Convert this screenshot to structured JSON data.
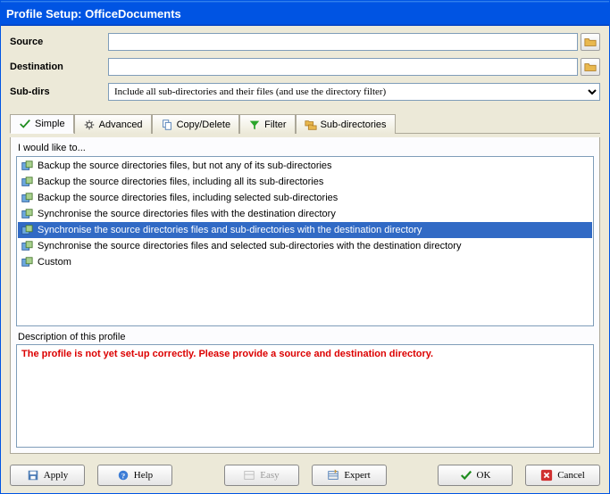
{
  "window": {
    "title": "Profile Setup: OfficeDocuments"
  },
  "form": {
    "source_label": "Source",
    "source_value": "",
    "dest_label": "Destination",
    "dest_value": "",
    "subdirs_label": "Sub-dirs",
    "subdirs_value": "Include all sub-directories and their files (and use the directory filter)"
  },
  "tabs": {
    "simple": "Simple",
    "advanced": "Advanced",
    "copydelete": "Copy/Delete",
    "filter": "Filter",
    "subdirectories": "Sub-directories"
  },
  "panel": {
    "prompt": "I would like to...",
    "options": [
      "Backup the source directories files, but not any of its sub-directories",
      "Backup the source directories files, including all its sub-directories",
      "Backup the source directories files, including selected sub-directories",
      "Synchronise the source directories files with the destination directory",
      "Synchronise the source directories files and sub-directories with the destination directory",
      "Synchronise the source directories files and selected sub-directories with the destination directory",
      "Custom"
    ],
    "selected_index": 4,
    "desc_label": "Description of this profile",
    "desc_text": "The profile is not yet set-up correctly. Please provide a source and destination directory."
  },
  "buttons": {
    "apply": "Apply",
    "help": "Help",
    "easy": "Easy",
    "expert": "Expert",
    "ok": "OK",
    "cancel": "Cancel"
  }
}
